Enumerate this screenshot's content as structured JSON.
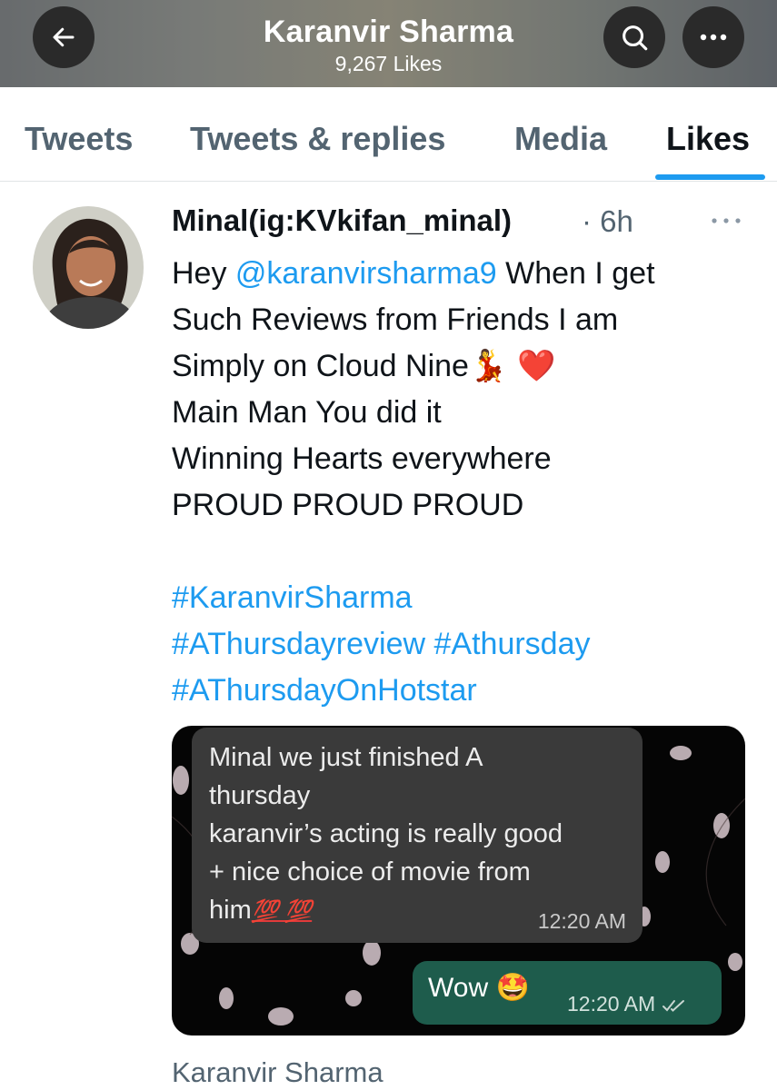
{
  "header": {
    "title": "Karanvir Sharma",
    "subtitle": "9,267 Likes",
    "back_icon": "arrow-left-icon",
    "search_icon": "search-icon",
    "more_icon": "ellipsis-icon"
  },
  "tabs": [
    {
      "label": "Tweets",
      "active": false
    },
    {
      "label": "Tweets & replies",
      "active": false
    },
    {
      "label": "Media",
      "active": false
    },
    {
      "label": "Likes",
      "active": true
    }
  ],
  "tweet": {
    "author": "Minal(ig:KVkifan_minal)",
    "time": "· 6h",
    "body": {
      "line1_prefix": "Hey ",
      "mention": "@karanvirsharma9",
      "line1_suffix": " When I get",
      "line2": "Such Reviews from Friends I am",
      "line3": "Simply on Cloud Nine",
      "line3_emoji": "💃 ❤️",
      "line4": "Main Man You did it",
      "line5": "Winning Hearts everywhere",
      "line6": "PROUD PROUD PROUD",
      "hashtags": [
        "#KaranvirSharma",
        "#AThursdayreview",
        "#Athursday",
        "#AThursdayOnHotstar"
      ]
    },
    "media": {
      "incoming": {
        "lines": [
          "Minal we just finished A",
          "thursday",
          "karanvir’s acting is really good",
          "+ nice choice of movie from",
          "him"
        ],
        "emoji": "💯 💯",
        "time": "12:20 AM"
      },
      "outgoing": {
        "text": "Wow",
        "emoji": "🤩",
        "time": "12:20 AM",
        "status_icon": "double-check-icon"
      }
    },
    "footer": "Karanvir Sharma"
  },
  "colors": {
    "accent": "#1d9bf0",
    "secondary_text": "#536471",
    "incoming_bubble": "#3a3a3a",
    "outgoing_bubble": "#1e5c4c"
  }
}
